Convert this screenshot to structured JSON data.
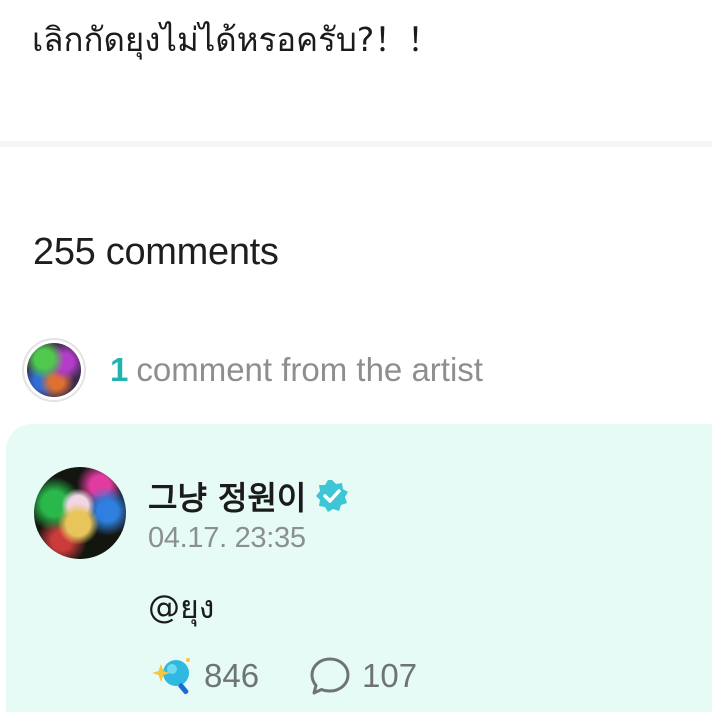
{
  "post": {
    "text": "เลิกกัดยุงไม่ได้หรอครับ?！！"
  },
  "comments": {
    "count_label": "255 comments"
  },
  "artist_summary": {
    "count": "1",
    "label": "comment from the artist"
  },
  "artist_comment": {
    "author": "그냥 정원이",
    "timestamp": "04.17. 23:35",
    "body": "@ยุง",
    "likes": "846",
    "replies": "107"
  },
  "icons": {
    "verified": "verified-check-icon",
    "like": "sparkle-like-icon",
    "reply": "speech-bubble-icon"
  },
  "colors": {
    "accent": "#1fb5ae",
    "card_background": "#e6fbf6",
    "verified": "#3ec6d6"
  }
}
